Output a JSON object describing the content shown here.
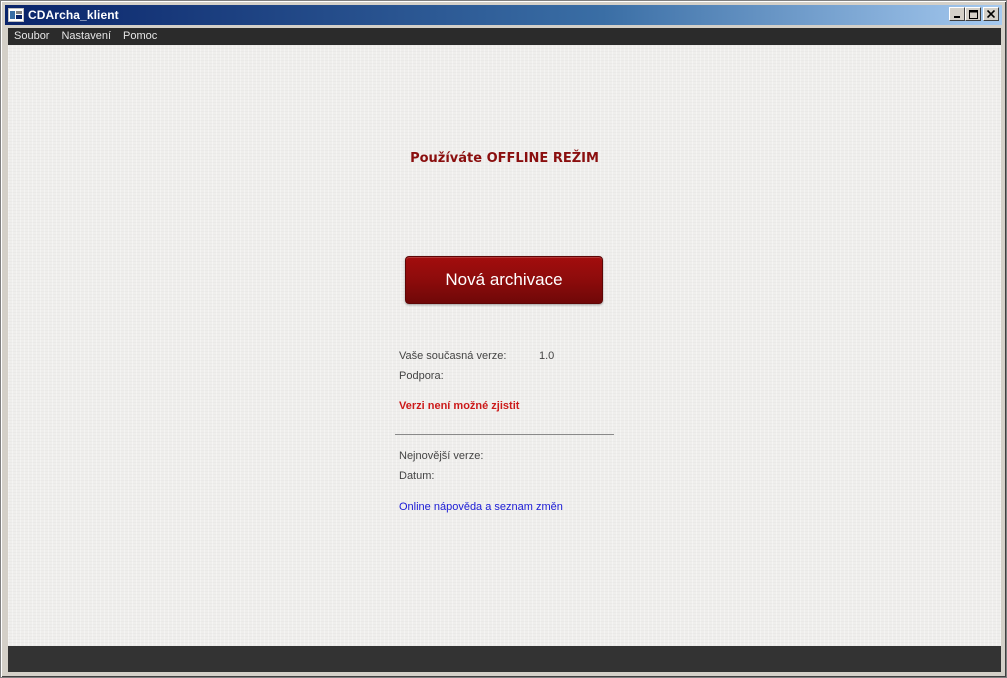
{
  "window": {
    "title": "CDArcha_klient",
    "minimize_glyph": "_",
    "close_glyph": "✕"
  },
  "menu": {
    "items": [
      "Soubor",
      "Nastavení",
      "Pomoc"
    ]
  },
  "main": {
    "mode_title": "Používáte OFFLINE REŽIM",
    "new_archive_button": "Nová archivace",
    "current_version_label": "Vaše současná verze:",
    "current_version_value": "1.0",
    "support_label": "Podpora:",
    "version_error": "Verzi není možné zjistit",
    "newest_version_label": "Nejnovější verze:",
    "date_label": "Datum:",
    "help_link": "Online nápověda a seznam změn"
  },
  "colors": {
    "accent_red": "#8a0e0e",
    "warning_red": "#cc1a1a",
    "link_blue": "#1a1ad6",
    "menubar": "#2b2b2b"
  }
}
